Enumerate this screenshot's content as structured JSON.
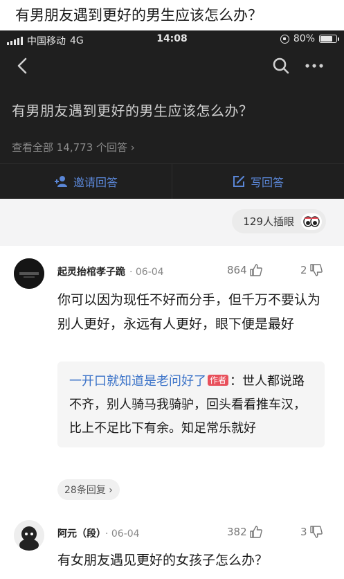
{
  "caption": "有男朋友遇到更好的男生应该怎么办？",
  "status_bar": {
    "carrier": "中国移动",
    "network": "4G",
    "time": "14:08",
    "battery": "80%",
    "battery_level": 0.8
  },
  "icons": {
    "back": "back-arrow-icon",
    "search": "search-icon",
    "more": "more-dots-icon"
  },
  "question": {
    "title": "有男朋友遇到更好的男生应该怎么办？",
    "view_all": "查看全部 14,773 个回答 ›"
  },
  "actions": {
    "invite": "邀请回答",
    "write": "写回答"
  },
  "insert_pill": "129人插眼",
  "comments": [
    {
      "name": "起灵抬棺孝子跪",
      "date": "· 06-04",
      "likes": "864",
      "dislikes": "2",
      "body": "你可以因为现任不好而分手，但千万不要认为别人更好，永远有人更好，眼下便是最好",
      "reply": {
        "author": "一开口就知道是老问好了",
        "tag": "作者",
        "text": "：世人都说路不齐，别人骑马我骑驴，回头看看推车汉，比上不足比下有余。知足常乐就好"
      },
      "more_replies": "28条回复 ›"
    },
    {
      "name": "阿元（段）",
      "date": "· 06-04",
      "likes": "382",
      "dislikes": "3",
      "body": "有女朋友遇见更好的女孩子怎么办？"
    }
  ],
  "colors": {
    "dark_bg": "#1f1f1f",
    "accent_blue": "#5a86d6",
    "author_tag": "#e8505b",
    "reply_author": "#3a72c8"
  }
}
